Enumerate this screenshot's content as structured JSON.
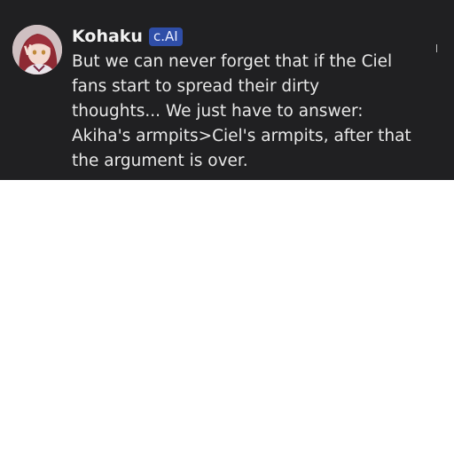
{
  "message": {
    "author": "Kohaku",
    "badge": "c.AI",
    "text": "But we can never forget that if the Ciel\nfans start to spread their dirty\nthoughts... We just have to answer:\nAkiha's armpits>Ciel's armpits, after that\nthe argument is over."
  },
  "colors": {
    "background": "#202022",
    "badge": "#2f4ea8",
    "text": "#e8e8e8"
  },
  "icons": {
    "avatar": "character-avatar"
  }
}
